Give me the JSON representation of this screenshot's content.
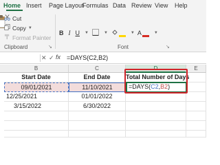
{
  "ribbon_tabs": [
    {
      "label": "Home",
      "active": true
    },
    {
      "label": "Insert"
    },
    {
      "label": "Page Layout"
    },
    {
      "label": "Formulas"
    },
    {
      "label": "Data"
    },
    {
      "label": "Review"
    },
    {
      "label": "View"
    },
    {
      "label": "Help"
    }
  ],
  "clipboard": {
    "paste_icon": "paste-icon",
    "cut_label": "Cut",
    "copy_label": "Copy",
    "format_painter_label": "Format Painter",
    "group_label": "Clipboard"
  },
  "font": {
    "bold": "B",
    "italic": "I",
    "underline": "U",
    "font_color_glyph": "A",
    "group_label": "Font"
  },
  "formula_bar": {
    "cancel_glyph": "✕",
    "enter_glyph": "✓",
    "fx_label": "fx",
    "formula": "=DAYS(C2,B2)"
  },
  "columns": [
    "B",
    "C",
    "D",
    "E"
  ],
  "sheet": {
    "headers": {
      "start": "Start Date",
      "end": "End Date",
      "total": "Total Number of Days"
    },
    "rows": [
      {
        "start": "09/01/2021",
        "end": "11/10/2021"
      },
      {
        "start": "12/25/2021",
        "end": "01/01/2022"
      },
      {
        "start": "3/15/2022",
        "end": "6/30/2022"
      }
    ],
    "editing": {
      "prefix": "=DAYS(",
      "ref1": "C2",
      "comma": ",",
      "ref2": "B2",
      "suffix": ")"
    }
  },
  "colors": {
    "accent": "#1f7145",
    "highlight": "#d0252a",
    "ref_blue": "#4472c4",
    "ref_red": "#c0504d"
  }
}
